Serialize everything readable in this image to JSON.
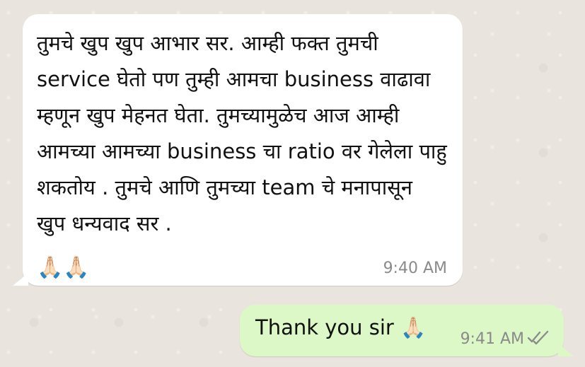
{
  "chat": {
    "incoming": {
      "text": "तुमचे खुप खुप आभार सर. आम्ही फक्त तुमची service घेतो पण तुम्ही आमचा business वाढावा म्हणून खुप मेहनत घेता. तुमच्यामुळेच आज आम्ही आमच्या आमच्या business चा ratio वर गेलेला पाहु शकतोय . तुमचे आणि तुमच्या team चे मनापासून खुप धन्यवाद सर .",
      "emoji": "🙏🏻🙏🏻",
      "time": "9:40 AM"
    },
    "outgoing": {
      "text": "Thank you sir 🙏🏻",
      "time": "9:41 AM",
      "status_icon": "double-check-icon"
    }
  }
}
